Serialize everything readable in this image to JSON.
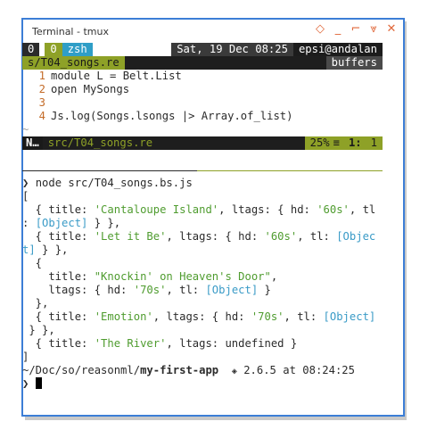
{
  "window": {
    "title": "Terminal - tmux",
    "buttons": [
      "◇",
      "_",
      "⌐",
      "⩔",
      "✕"
    ]
  },
  "tmux_top": {
    "pane_index": "0",
    "tab_index": "0",
    "tab_name": "zsh",
    "datetime": "Sat, 19 Dec 08:25",
    "user_host": "epsi@andalan"
  },
  "editor": {
    "file_tab": "s/T04_songs.re",
    "buffers_label": "buffers",
    "lines": [
      {
        "num": "1",
        "text": "module L = Belt.List"
      },
      {
        "num": "2",
        "text": "open MySongs"
      },
      {
        "num": "3",
        "text": ""
      },
      {
        "num": "4",
        "text": "Js.log(Songs.lsongs |> Array.of_list)"
      }
    ],
    "empty_marker": "~",
    "status": {
      "mode": "N…",
      "file": "src/T04_songs.re",
      "percent": "25%",
      "lines_icon": "≡",
      "line": "1:",
      "col": "1"
    }
  },
  "shell": {
    "prompt_char": "❯",
    "command": "node src/T04_songs.bs.js",
    "output": [
      "[",
      "  { title: 'Cantaloupe Island', ltags: { hd: '60s', tl",
      ": [Object] } },",
      "  { title: 'Let it Be', ltags: { hd: '60s', tl: [Objec",
      "t] } },",
      "  {",
      "    title: \"Knockin' on Heaven's Door\",",
      "    ltags: { hd: '70s', tl: [Object] }",
      "  },",
      "  { title: 'Emotion', ltags: { hd: '70s', tl: [Object]",
      " } },",
      "  { title: 'The River', ltags: undefined }",
      "]"
    ],
    "cwd_prefix": "~/Doc/so/reasonml/",
    "cwd_last": "my-first-app",
    "ruby_icon": "💎",
    "ruby_version": "2.6.5",
    "at": "at",
    "time": "08:24:25"
  },
  "colors": {
    "window_border": "#3c7ed6",
    "accent_orange": "#e0683b",
    "tmux_green": "#8ea127",
    "tmux_blue": "#2f9ec7",
    "string_green": "#4f9c2f",
    "object_cyan": "#3a9bc7"
  }
}
